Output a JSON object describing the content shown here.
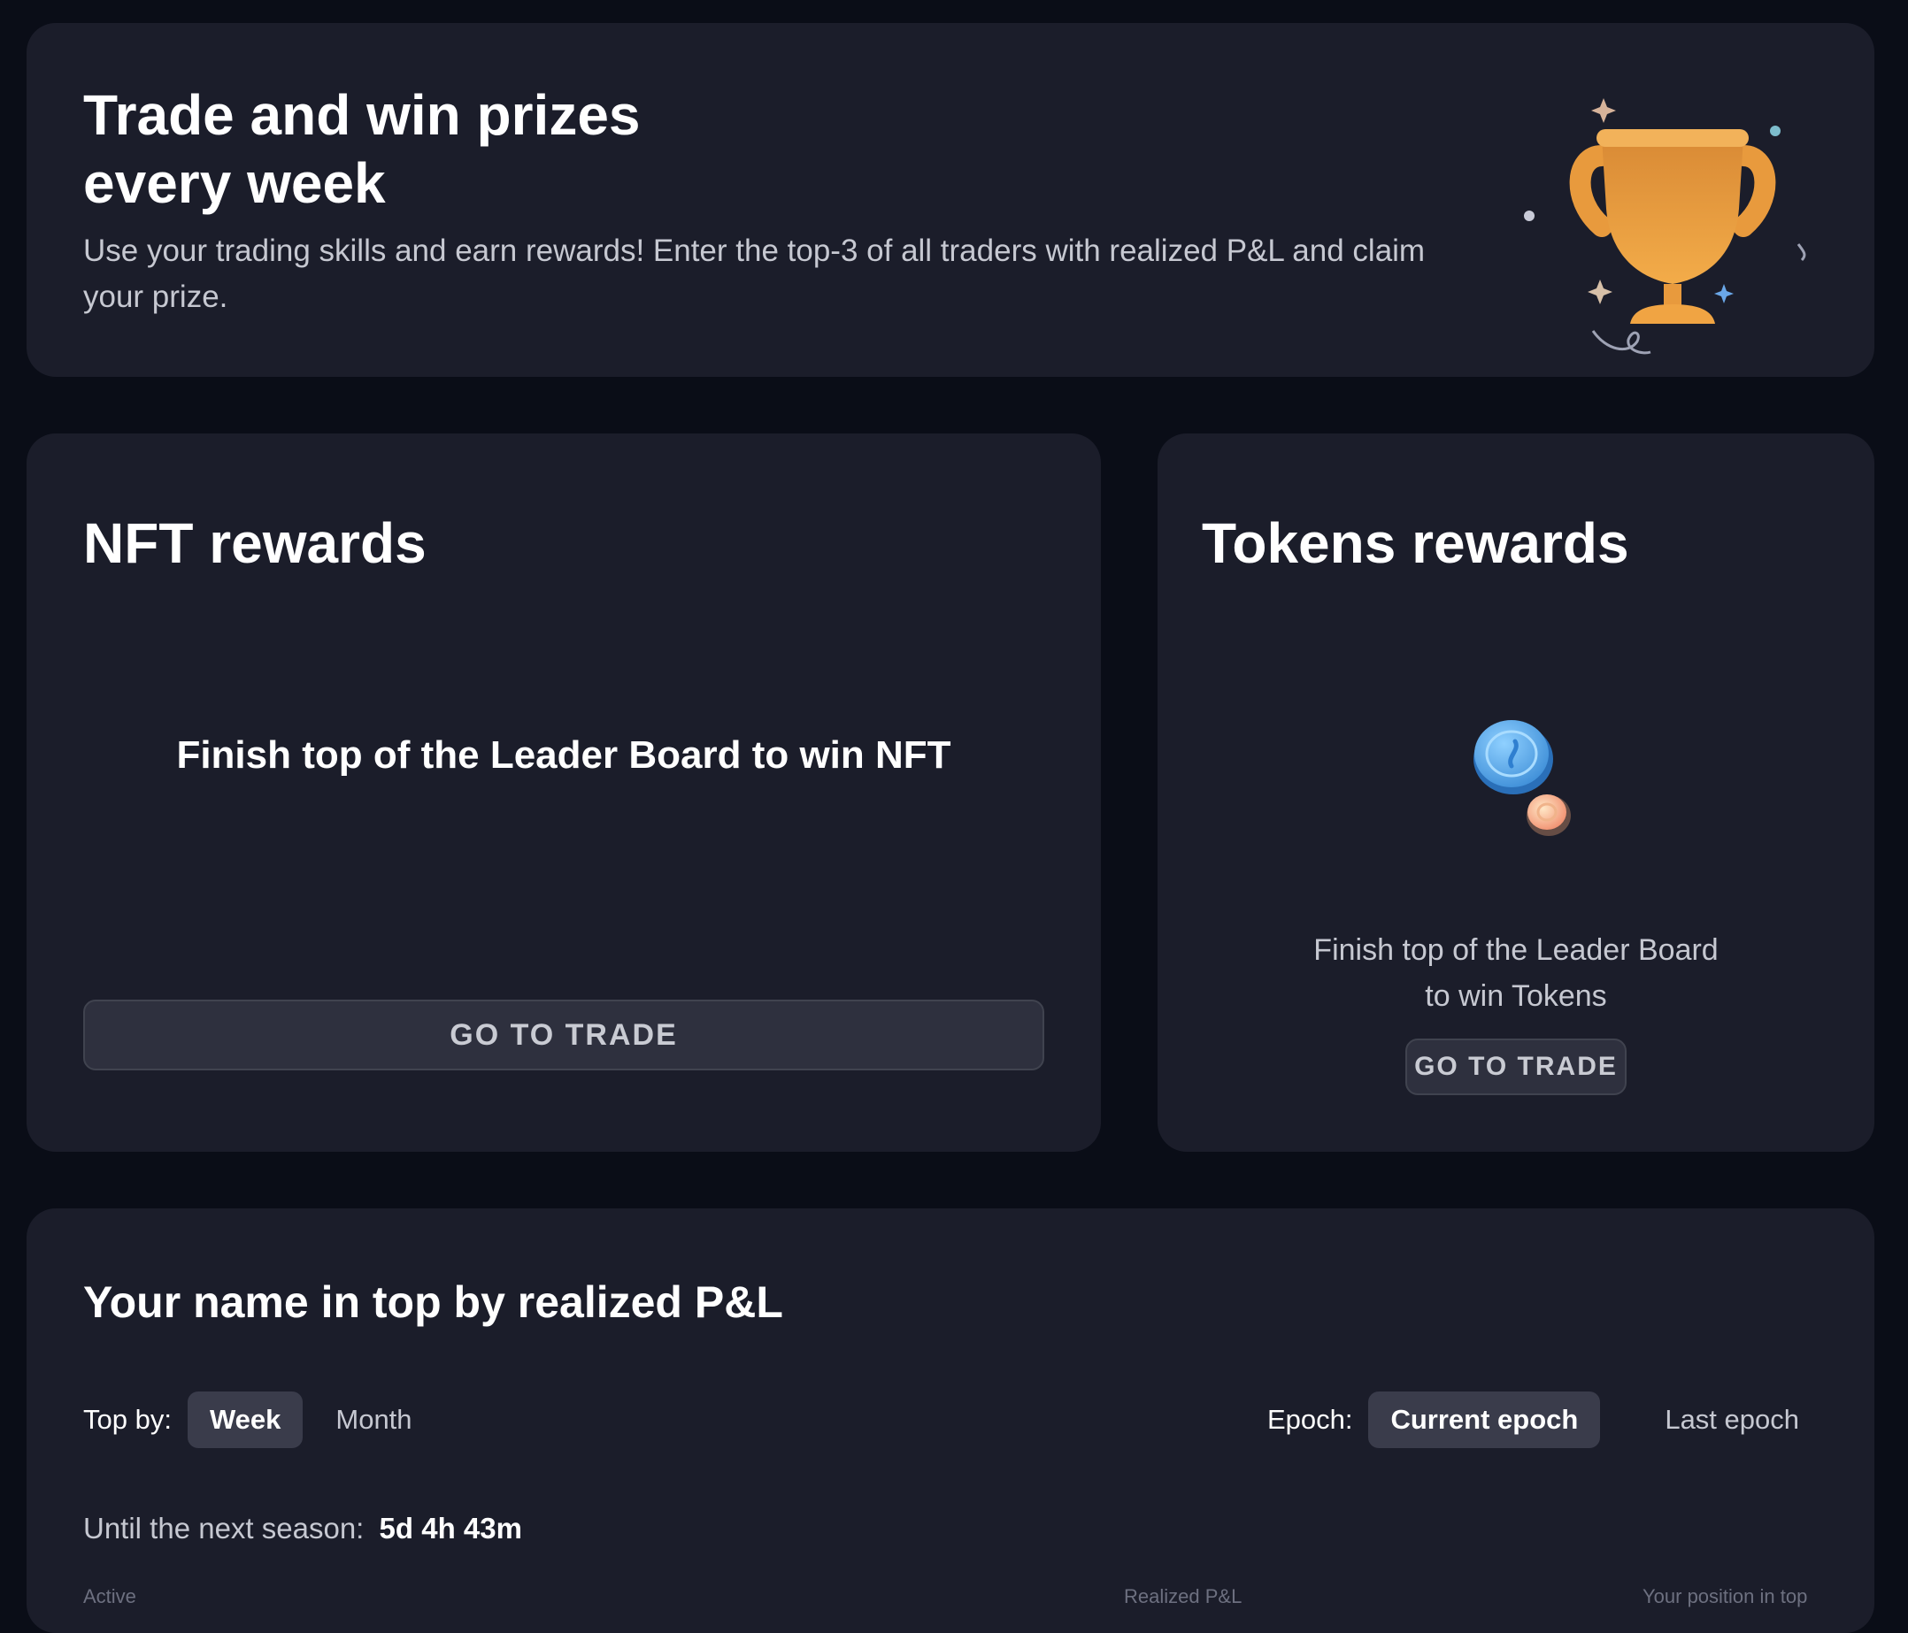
{
  "hero": {
    "title_line1": "Trade and win prizes",
    "title_line2": "every week",
    "description": "Use your trading skills and earn rewards! Enter the top-3 of all traders with realized P&L and claim your prize."
  },
  "nft": {
    "title": "NFT rewards",
    "message": "Finish top of the Leader Board to win NFT",
    "button": "GO TO TRADE"
  },
  "tokens": {
    "title": "Tokens rewards",
    "message_line1": "Finish top of the Leader Board",
    "message_line2": "to win Tokens",
    "button": "GO TO TRADE"
  },
  "board": {
    "title": "Your name in top by realized P&L",
    "top_by_label": "Top by:",
    "top_by_options": [
      "Week",
      "Month"
    ],
    "top_by_selected": "Week",
    "epoch_label": "Epoch:",
    "epoch_options": [
      "Current epoch",
      "Last epoch"
    ],
    "epoch_selected": "Current epoch",
    "season_label": "Until the next season:",
    "season_value": "5d 4h 43m",
    "columns": [
      "Active",
      "Realized P&L",
      "Your position in top"
    ]
  },
  "colors": {
    "page_bg": "#0a0d17",
    "card_bg": "#1b1d2a",
    "button_bg": "#2e303e",
    "trophy": "#e8a03e",
    "coin_blue": "#5aaef0"
  }
}
